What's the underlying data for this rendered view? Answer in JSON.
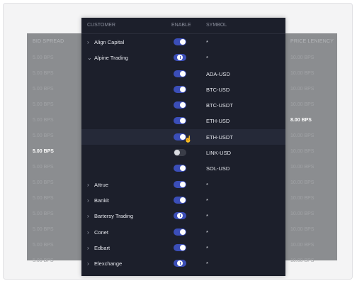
{
  "headers": {
    "bid_spread": "BID SPREAD",
    "customer": "CUSTOMER",
    "enable": "ENABLE",
    "symbol": "SYMBOL",
    "price_leniency": "PRICE LENIENCY"
  },
  "bid_spread_values": [
    "5.00 BPS",
    "5.00 BPS",
    "5.00 BPS",
    "5.00 BPS",
    "5.00 BPS",
    "5.00 BPS",
    "5.00 BPS",
    "5.00 BPS",
    "5.00 BPS",
    "5.00 BPS",
    "5.00 BPS",
    "5.00 BPS",
    "5.00 BPS",
    "5.00 BPS"
  ],
  "price_leniency_values": [
    "10.00 BPS",
    "10.00 BPS",
    "10.00 BPS",
    "10.00 BPS",
    "8.00 BPS",
    "10.00 BPS",
    "10.00 BPS",
    "10.00 BPS",
    "10.00 BPS",
    "10.00 BPS",
    "10.00 BPS",
    "10.00 BPS",
    "10.00 BPS",
    "10.00 BPS"
  ],
  "rows": [
    {
      "customer": "Align Capital",
      "chevron": "›",
      "enable": "on",
      "symbol": "*"
    },
    {
      "customer": "Alpine Trading",
      "chevron": "⌄",
      "enable": "partial",
      "symbol": "*"
    },
    {
      "customer": "",
      "chevron": "",
      "enable": "on",
      "symbol": "ADA-USD"
    },
    {
      "customer": "",
      "chevron": "",
      "enable": "on",
      "symbol": "BTC-USD"
    },
    {
      "customer": "",
      "chevron": "",
      "enable": "on",
      "symbol": "BTC-USDT"
    },
    {
      "customer": "",
      "chevron": "",
      "enable": "on",
      "symbol": "ETH-USD"
    },
    {
      "customer": "",
      "chevron": "",
      "enable": "on",
      "symbol": "ETH-USDT"
    },
    {
      "customer": "",
      "chevron": "",
      "enable": "off",
      "symbol": "LINK-USD"
    },
    {
      "customer": "",
      "chevron": "",
      "enable": "on",
      "symbol": "SOL-USD"
    },
    {
      "customer": "Attrue",
      "chevron": "›",
      "enable": "on",
      "symbol": "*"
    },
    {
      "customer": "Bankit",
      "chevron": "›",
      "enable": "on",
      "symbol": "*"
    },
    {
      "customer": "Bartersy Trading",
      "chevron": "›",
      "enable": "partial",
      "symbol": "*"
    },
    {
      "customer": "Conet",
      "chevron": "›",
      "enable": "on",
      "symbol": "*"
    },
    {
      "customer": "Edbart",
      "chevron": "›",
      "enable": "on",
      "symbol": "*"
    },
    {
      "customer": "Elexchange",
      "chevron": "›",
      "enable": "partial",
      "symbol": "*"
    }
  ]
}
